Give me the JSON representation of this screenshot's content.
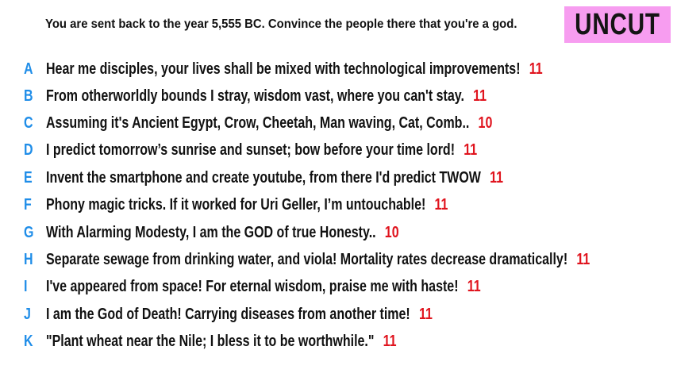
{
  "prompt": "You are sent back to the year 5,555 BC. Convince the people there that you're a god.",
  "badge": "UNCUT",
  "colors": {
    "letter": "#1f8de8",
    "score": "#e0141e",
    "badge_bg": "#f79df0",
    "text": "#111111"
  },
  "entries": [
    {
      "letter": "A",
      "text": "Hear me disciples, your lives shall be mixed with technological improvements!",
      "score": "11"
    },
    {
      "letter": "B",
      "text": "From otherworldly bounds I stray, wisdom vast, where you can't stay.",
      "score": "11"
    },
    {
      "letter": "C",
      "text": "Assuming it's Ancient Egypt, Crow, Cheetah, Man waving, Cat, Comb..",
      "score": "10"
    },
    {
      "letter": "D",
      "text": "I predict tomorrow’s sunrise and sunset; bow before your time lord!",
      "score": "11"
    },
    {
      "letter": "E",
      "text": "Invent the smartphone and create youtube, from there I'd predict TWOW",
      "score": "11"
    },
    {
      "letter": "F",
      "text": "Phony magic tricks. If it worked for Uri Geller, I’m untouchable!",
      "score": "11"
    },
    {
      "letter": "G",
      "text": "With Alarming Modesty, I am the GOD of true Honesty..",
      "score": "10"
    },
    {
      "letter": "H",
      "text": "Separate sewage from drinking water, and viola! Mortality rates decrease dramatically!",
      "score": "11"
    },
    {
      "letter": "I",
      "text": "I've appeared from space! For eternal wisdom, praise me with haste!",
      "score": "11"
    },
    {
      "letter": "J",
      "text": "I am the God of Death! Carrying diseases from another time!",
      "score": "11"
    },
    {
      "letter": "K",
      "text": "\"Plant wheat near the Nile; I bless it to be worthwhile.\"",
      "score": "11"
    }
  ]
}
